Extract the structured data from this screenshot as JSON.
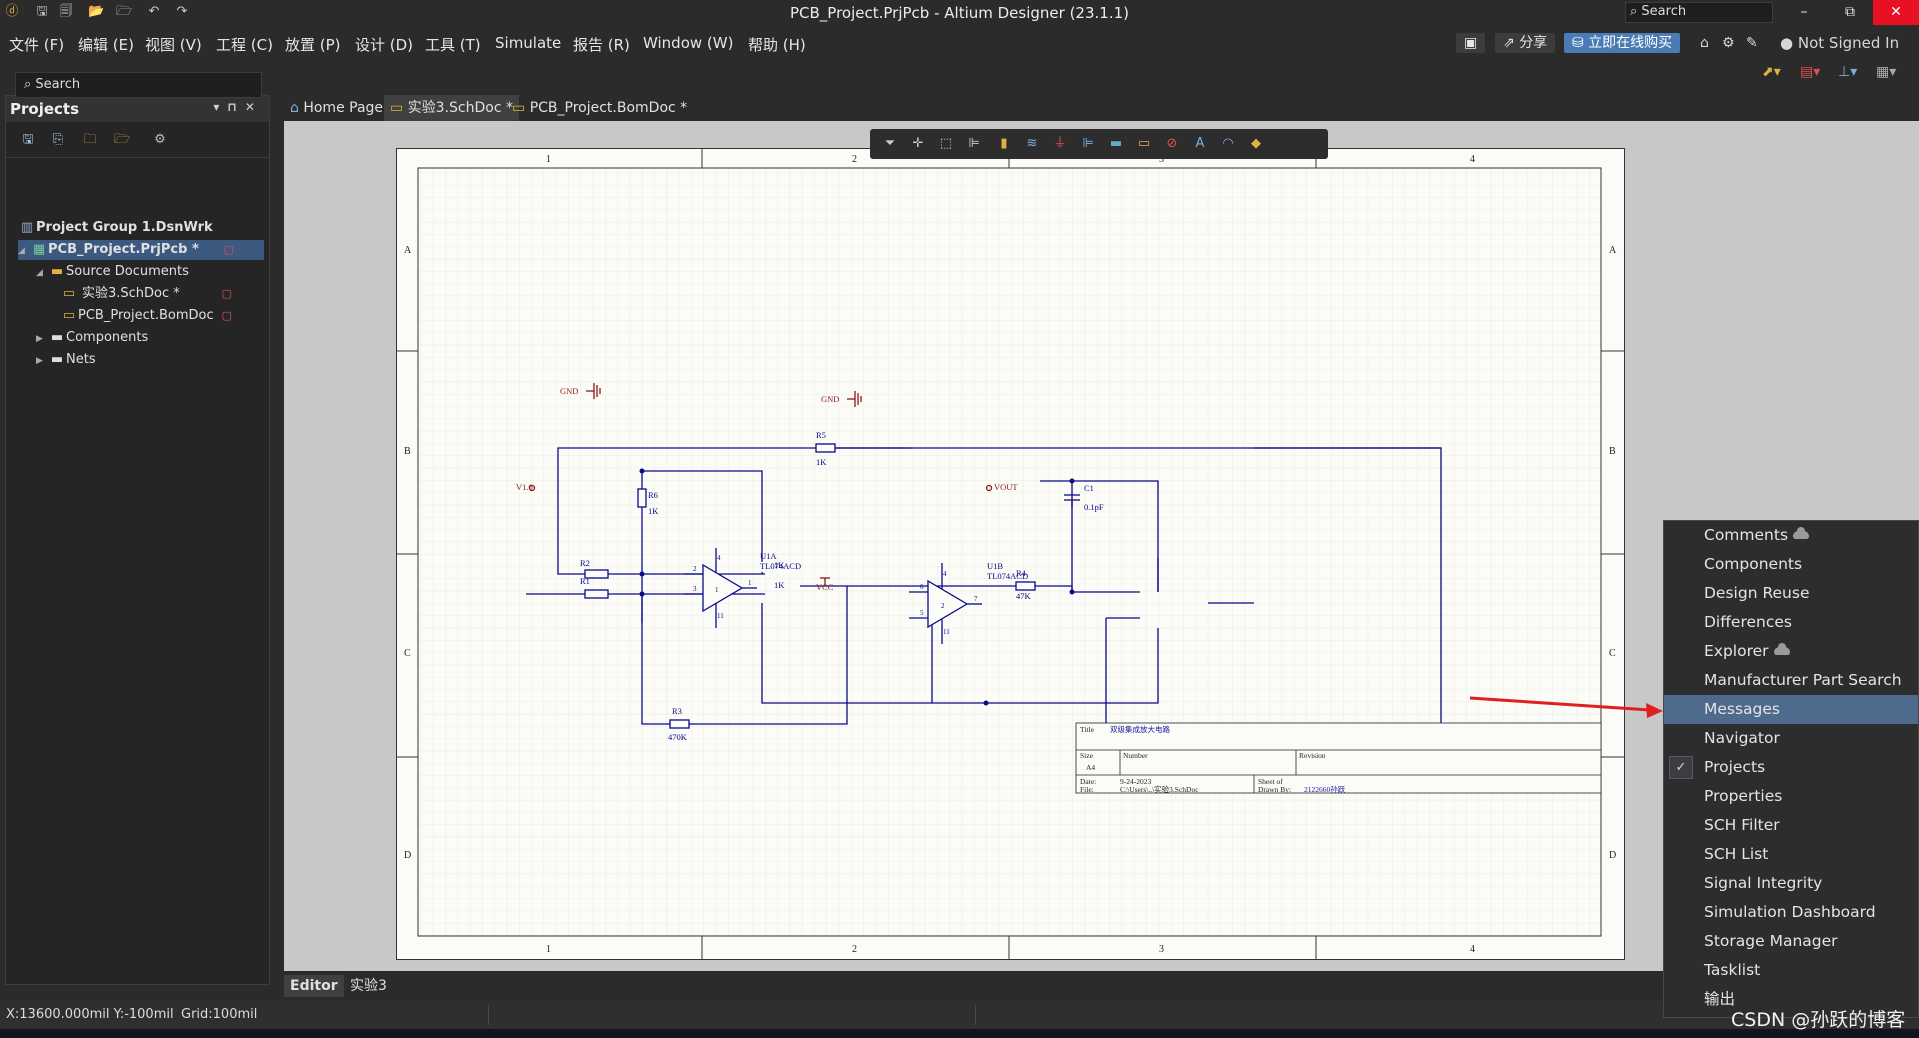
{
  "window": {
    "title": "PCB_Project.PrjPcb - Altium Designer (23.1.1)",
    "search_label": "Search",
    "minimize": "–",
    "restore": "⧉",
    "close": "✕"
  },
  "menu": [
    "文件 (F)",
    "编辑 (E)",
    "视图 (V)",
    "工程 (C)",
    "放置 (P)",
    "设计 (D)",
    "工具 (T)",
    "Simulate",
    "报告 (R)",
    "Window (W)",
    "帮助 (H)"
  ],
  "topbar": {
    "share_label": "分享",
    "buy_label": "立即在线购买",
    "user_label": "Not Signed In"
  },
  "projects_panel": {
    "title": "Projects",
    "search_placeholder": "Search",
    "tree": [
      {
        "label": "Project Group 1.DsnWrk"
      },
      {
        "label": "PCB_Project.PrjPcb *"
      },
      {
        "label": "Source Documents"
      },
      {
        "label": "实验3.SchDoc *"
      },
      {
        "label": "PCB_Project.BomDoc"
      },
      {
        "label": "Components"
      },
      {
        "label": "Nets"
      }
    ]
  },
  "doc_tabs": [
    "Home Page",
    "实验3.SchDoc *",
    "PCB_Project.BomDoc *"
  ],
  "schematic": {
    "col_labels": [
      "1",
      "2",
      "3",
      "4"
    ],
    "row_labels": [
      "A",
      "B",
      "C",
      "D"
    ],
    "parts": {
      "r5": "R5",
      "r5_val": "1K",
      "r6": "R6",
      "r6_val": "1K",
      "r2": "R2",
      "r2_val": "1K",
      "r1": "R1",
      "r1_val": "1K",
      "r4": "R4",
      "r4_val": "47K",
      "r3": "R3",
      "r3_val": "470K",
      "c1": "C1",
      "c1_val": "0.1pF",
      "u1a": "U1A",
      "u1a_val": "TL074ACD",
      "u1b": "U1B",
      "u1b_val": "TL074ACD",
      "gnd": "GND",
      "vcc": "VCC",
      "vin": "V1.0",
      "vout": "VOUT"
    },
    "pins": {
      "u1a_in_neg": "2",
      "u1a_in_pos": "3",
      "u1a_out": "1",
      "u1a_v_pos": "4",
      "u1a_v_neg": "11",
      "u1a_unit": "1",
      "u1b_in_neg": "6",
      "u1b_in_pos": "5",
      "u1b_out": "7",
      "u1b_v_pos": "4",
      "u1b_v_neg": "11",
      "u1b_unit": "2"
    },
    "title_block": {
      "title_label": "Title",
      "title_value": "双级集成放大电路",
      "size_label": "Size",
      "size_value": "A4",
      "number_label": "Number",
      "revision_label": "Revision",
      "date_label": "Date:",
      "date_value": "9-24-2023",
      "file_label": "File:",
      "file_value": "C:\\Users\\..\\实验3.SchDoc",
      "sheet_label": "Sheet   of",
      "drawn_label": "Drawn By:",
      "drawn_value": "2122660孙跃"
    }
  },
  "bottom_tabs": [
    "Editor",
    "实验3"
  ],
  "status": {
    "coords": "X:13600.000mil Y:-100mil",
    "grid": "Grid:100mil"
  },
  "panels_menu": {
    "items": [
      {
        "label": "Comments"
      },
      {
        "label": "Components"
      },
      {
        "label": "Design Reuse"
      },
      {
        "label": "Differences"
      },
      {
        "label": "Explorer"
      },
      {
        "label": "Manufacturer Part Search"
      },
      {
        "label": "Messages"
      },
      {
        "label": "Navigator"
      },
      {
        "label": "Projects"
      },
      {
        "label": "Properties"
      },
      {
        "label": "SCH Filter"
      },
      {
        "label": "SCH List"
      },
      {
        "label": "Signal Integrity"
      },
      {
        "label": "Simulation Dashboard"
      },
      {
        "label": "Storage Manager"
      },
      {
        "label": "Tasklist"
      },
      {
        "label": "输出"
      }
    ],
    "highlighted": "Messages",
    "checked": "Projects"
  },
  "watermark": "CSDN @孙跃的博客",
  "colors": {
    "accent": "#4e6a8c",
    "wire": "#0a0a8a",
    "power": "#8b1a1a",
    "arrow": "#e02020",
    "close_button": "#e81123"
  }
}
